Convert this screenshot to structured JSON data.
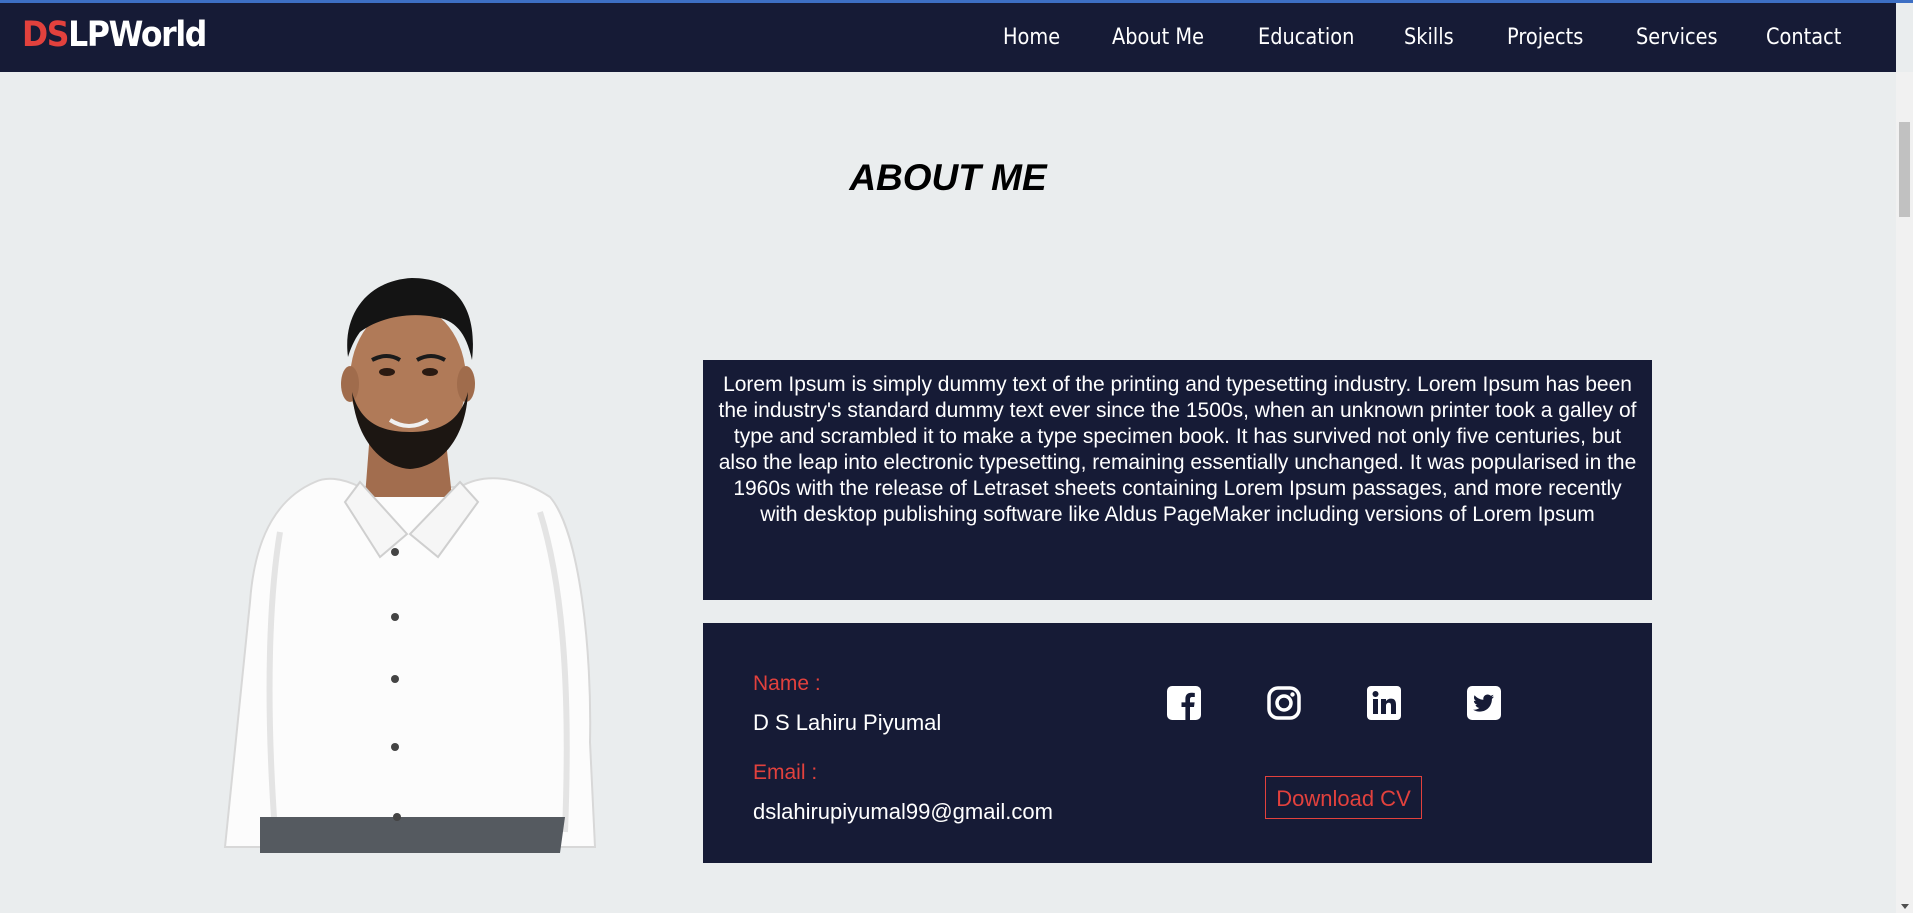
{
  "brand": {
    "prefix": "DS",
    "name": "LPWorld"
  },
  "nav": [
    {
      "label": "Home"
    },
    {
      "label": "About Me"
    },
    {
      "label": "Education"
    },
    {
      "label": "Skills"
    },
    {
      "label": "Projects"
    },
    {
      "label": "Services"
    },
    {
      "label": "Contact"
    }
  ],
  "page_title": "ABOUT ME",
  "bio": "Lorem Ipsum is simply dummy text of the printing and typesetting industry. Lorem Ipsum has been the industry's standard dummy text ever since the 1500s, when an unknown printer took a galley of type and scrambled it to make a type specimen book. It has survived not only five centuries, but also the leap into electronic typesetting, remaining essentially unchanged. It was popularised in the 1960s with the release of Letraset sheets containing Lorem Ipsum passages, and more recently with desktop publishing software like Aldus PageMaker including versions of Lorem Ipsum",
  "info": {
    "name_label": "Name :",
    "name_value": "D S Lahiru Piyumal",
    "email_label": "Email :",
    "email_value": "dslahirupiyumal99@gmail.com"
  },
  "social_icons": [
    "facebook-icon",
    "instagram-icon",
    "linkedin-icon",
    "twitter-icon"
  ],
  "download_cv": "Download CV",
  "colors": {
    "navy": "#161b36",
    "accent": "#e2413d",
    "background": "#eaedee",
    "text_light": "#ffffff"
  }
}
